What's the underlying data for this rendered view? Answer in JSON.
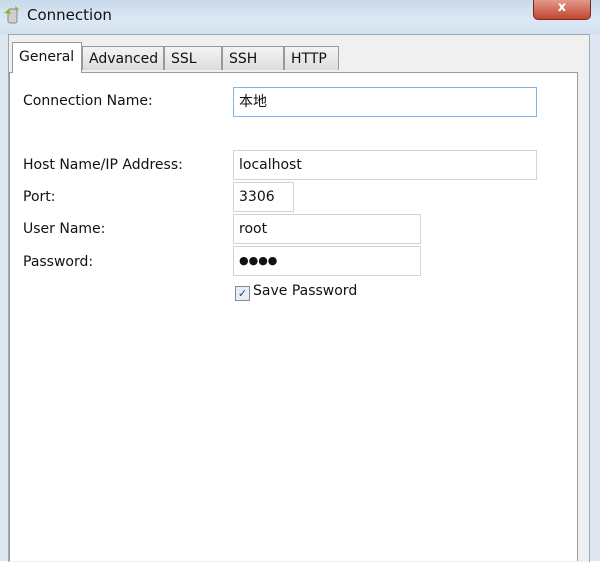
{
  "window": {
    "title": "Connection",
    "close_label": "x"
  },
  "tabs": [
    {
      "label": "General"
    },
    {
      "label": "Advanced"
    },
    {
      "label": "SSL"
    },
    {
      "label": "SSH"
    },
    {
      "label": "HTTP"
    }
  ],
  "form": {
    "connection_name": {
      "label": "Connection Name:",
      "value": "本地"
    },
    "host": {
      "label": "Host Name/IP Address:",
      "value": "localhost"
    },
    "port": {
      "label": "Port:",
      "value": "3306"
    },
    "user": {
      "label": "User Name:",
      "value": "root"
    },
    "password": {
      "label": "Password:",
      "value": "●●●●"
    },
    "save_password": {
      "label": "Save Password",
      "checked": true,
      "mark": "✓"
    }
  }
}
